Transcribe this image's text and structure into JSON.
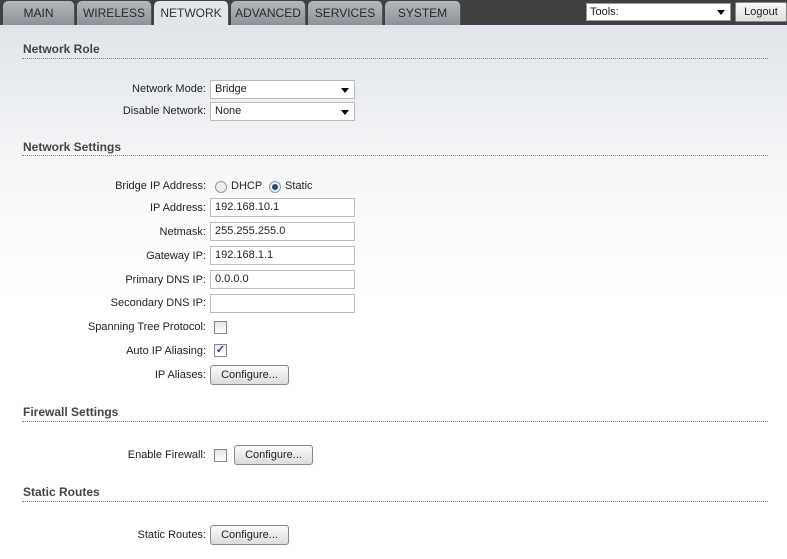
{
  "tabs": [
    "MAIN",
    "WIRELESS",
    "NETWORK",
    "ADVANCED",
    "SERVICES",
    "SYSTEM"
  ],
  "active_tab": "NETWORK",
  "tools": {
    "value": "Tools:"
  },
  "logout": "Logout",
  "network_role": {
    "title": "Network Role",
    "mode_label": "Network Mode:",
    "mode_value": "Bridge",
    "disable_label": "Disable Network:",
    "disable_value": "None"
  },
  "network_settings": {
    "title": "Network Settings",
    "bridge_label": "Bridge IP Address:",
    "dhcp": "DHCP",
    "static": "Static",
    "selected": "Static",
    "ip_label": "IP Address:",
    "ip": "192.168.10.1",
    "netmask_label": "Netmask:",
    "netmask": "255.255.255.0",
    "gateway_label": "Gateway IP:",
    "gateway": "192.168.1.1",
    "dns1_label": "Primary DNS IP:",
    "dns1": "0.0.0.0",
    "dns2_label": "Secondary DNS IP:",
    "dns2": "",
    "stp_label": "Spanning Tree Protocol:",
    "stp": false,
    "alias_auto_label": "Auto IP Aliasing:",
    "alias_auto": true,
    "aliases_label": "IP Aliases:",
    "configure": "Configure..."
  },
  "firewall": {
    "title": "Firewall Settings",
    "enable_label": "Enable Firewall:",
    "enabled": false,
    "configure": "Configure..."
  },
  "static_routes": {
    "title": "Static Routes",
    "label": "Static Routes:",
    "configure": "Configure..."
  },
  "checkmark": "✓"
}
